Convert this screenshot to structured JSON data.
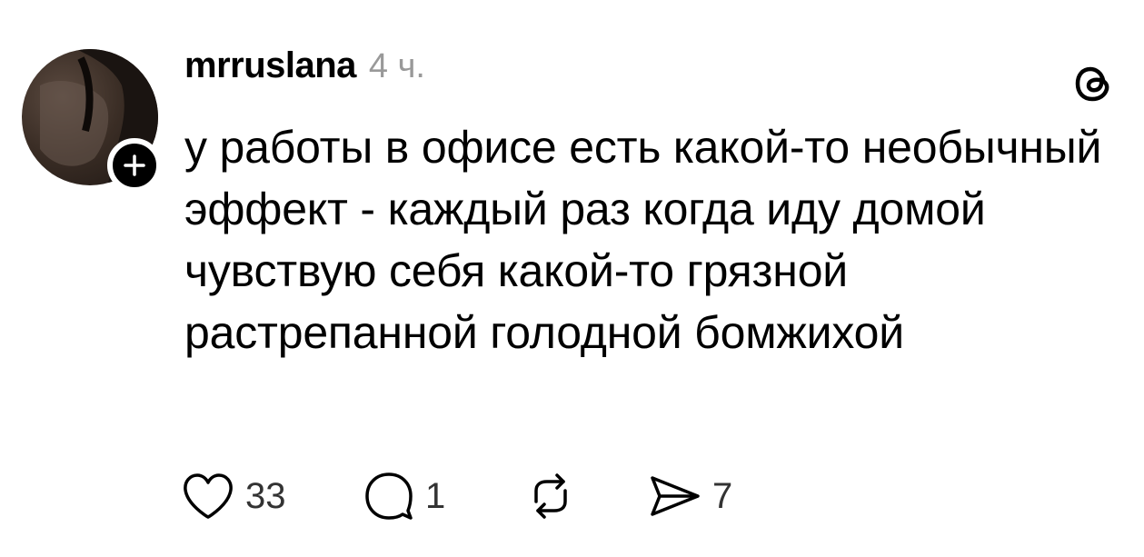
{
  "post": {
    "username": "mrruslana",
    "timestamp": "4 ч.",
    "text": "у работы в офисе есть какой-то необычный эффект - каждый раз когда иду домой чувствую себя какой-то грязной растрепанной голодной бомжихой",
    "likes": "33",
    "replies": "1",
    "shares": "7"
  },
  "icons": {
    "avatar": "avatar",
    "follow": "plus-icon",
    "brand": "threads-logo-icon",
    "like": "heart-icon",
    "reply": "comment-icon",
    "repost": "repost-icon",
    "share": "send-icon"
  },
  "colors": {
    "text": "#000000",
    "muted": "#999999",
    "badge": "#000000",
    "background": "#ffffff"
  }
}
